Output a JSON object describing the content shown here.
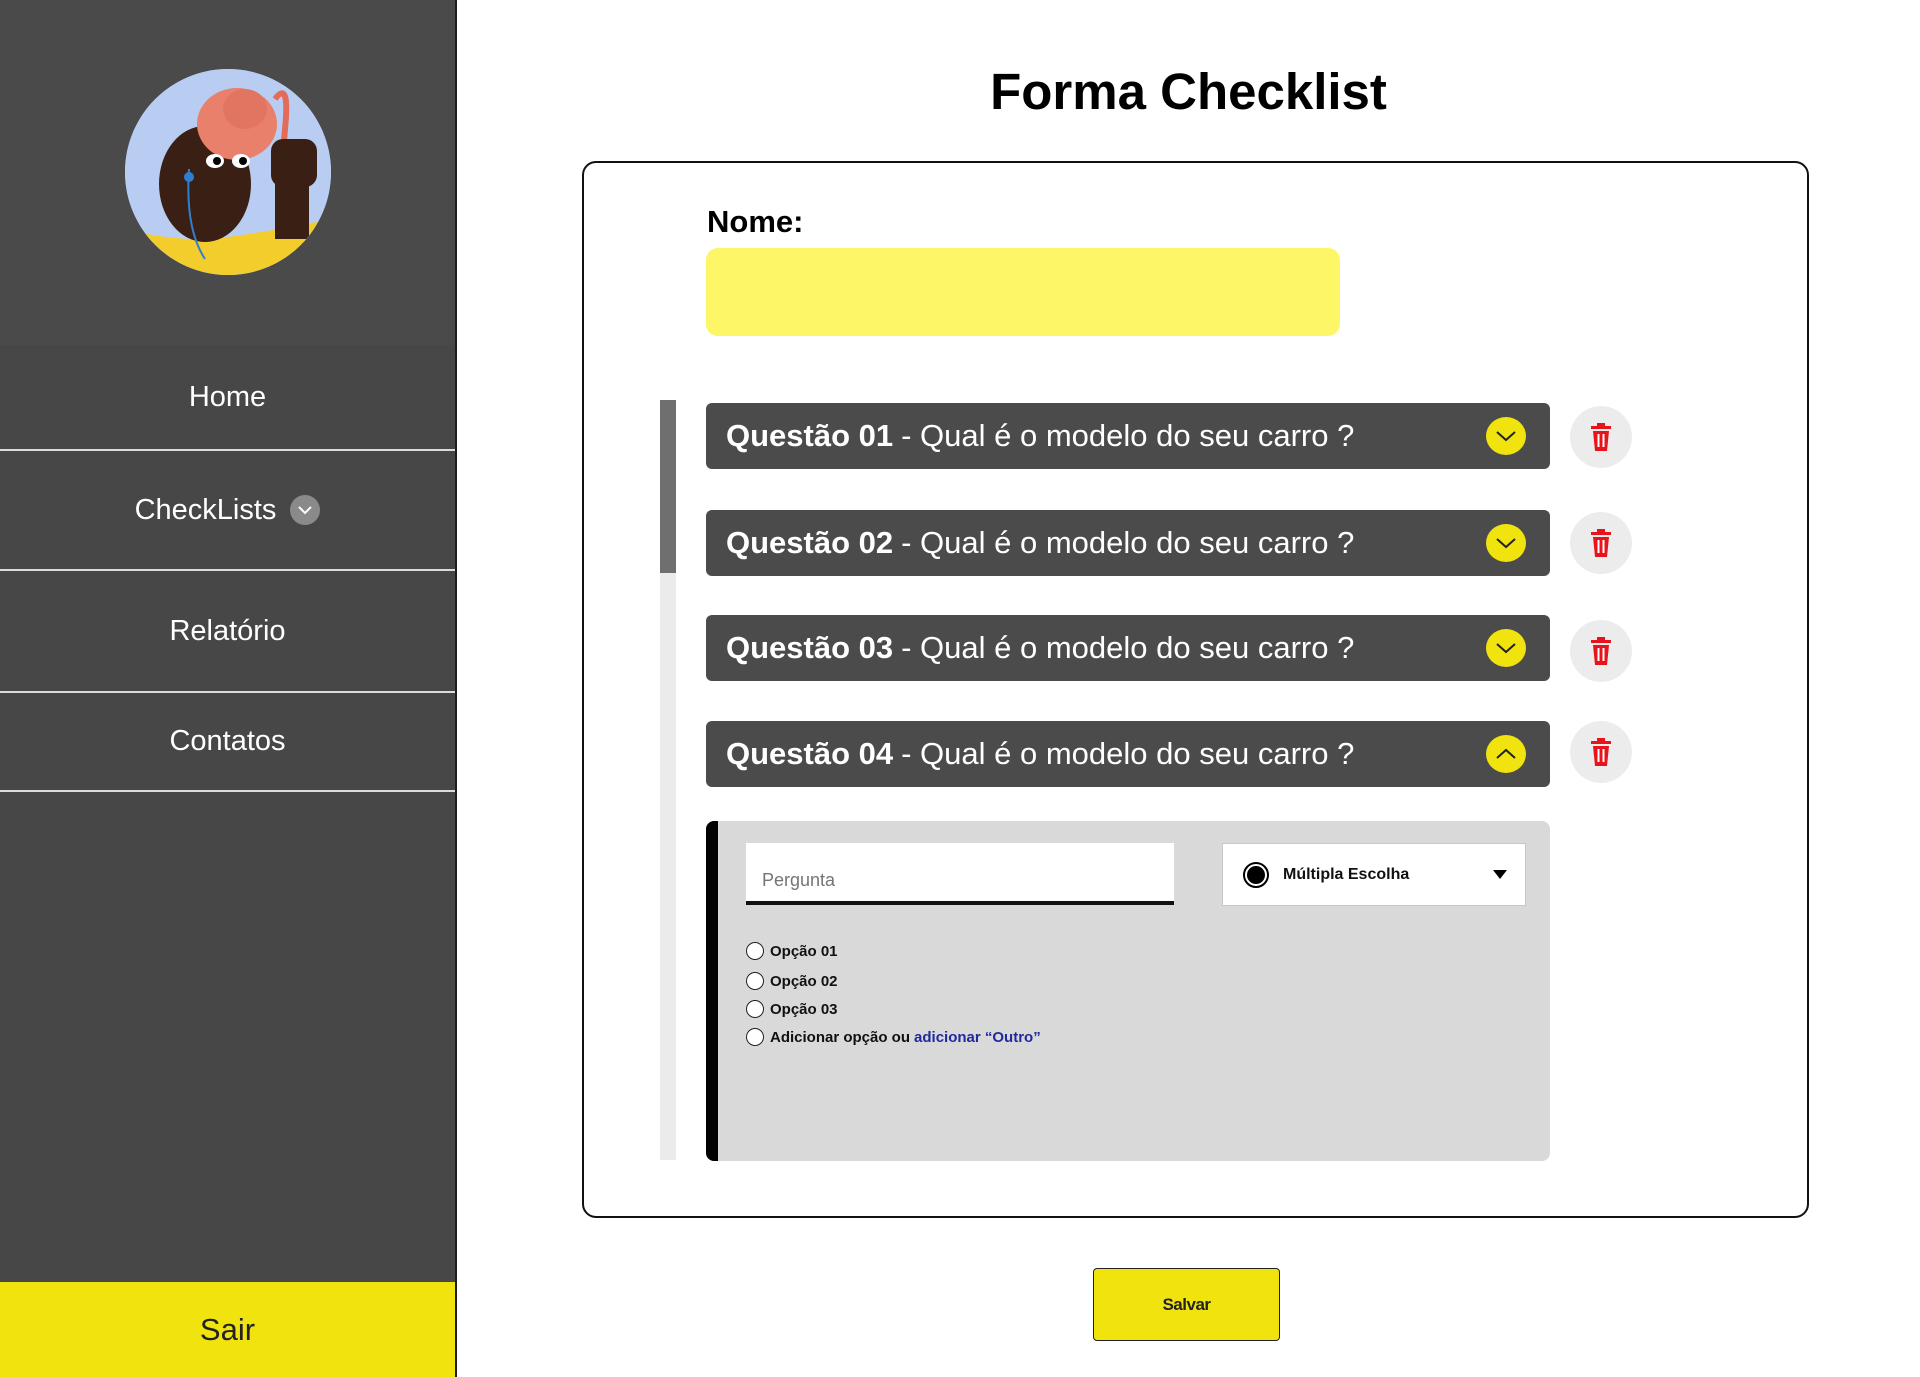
{
  "sidebar": {
    "nav": [
      {
        "label": "Home"
      },
      {
        "label": "CheckLists"
      },
      {
        "label": "Relatório"
      },
      {
        "label": "Contatos"
      }
    ],
    "logout_label": "Sair"
  },
  "main": {
    "title": "Forma Checklist",
    "name_label": "Nome:",
    "name_value": "",
    "questions": [
      {
        "num": "Questão 01",
        "text": "- Qual é o modelo do seu carro ?",
        "expanded": false
      },
      {
        "num": "Questão 02",
        "text": "- Qual é o modelo do seu carro ?",
        "expanded": false
      },
      {
        "num": "Questão 03",
        "text": "- Qual é o modelo do seu carro ?",
        "expanded": false
      },
      {
        "num": "Questão 04",
        "text": "- Qual é o modelo do seu carro ?",
        "expanded": true
      }
    ],
    "editor": {
      "question_placeholder": "Pergunta",
      "type_selected": "Múltipla Escolha",
      "options": [
        "Opção 01",
        "Opção 02",
        "Opção 03"
      ],
      "add_option_text": "Adicionar opção ou",
      "add_other_link": "adicionar “Outro”"
    },
    "save_label": "Salvar"
  },
  "colors": {
    "accent_yellow": "#f1e40e",
    "input_yellow": "#fdf666",
    "sidebar_bg": "#474747",
    "question_bar": "#4b4b4b",
    "delete_red": "#e8141c"
  }
}
